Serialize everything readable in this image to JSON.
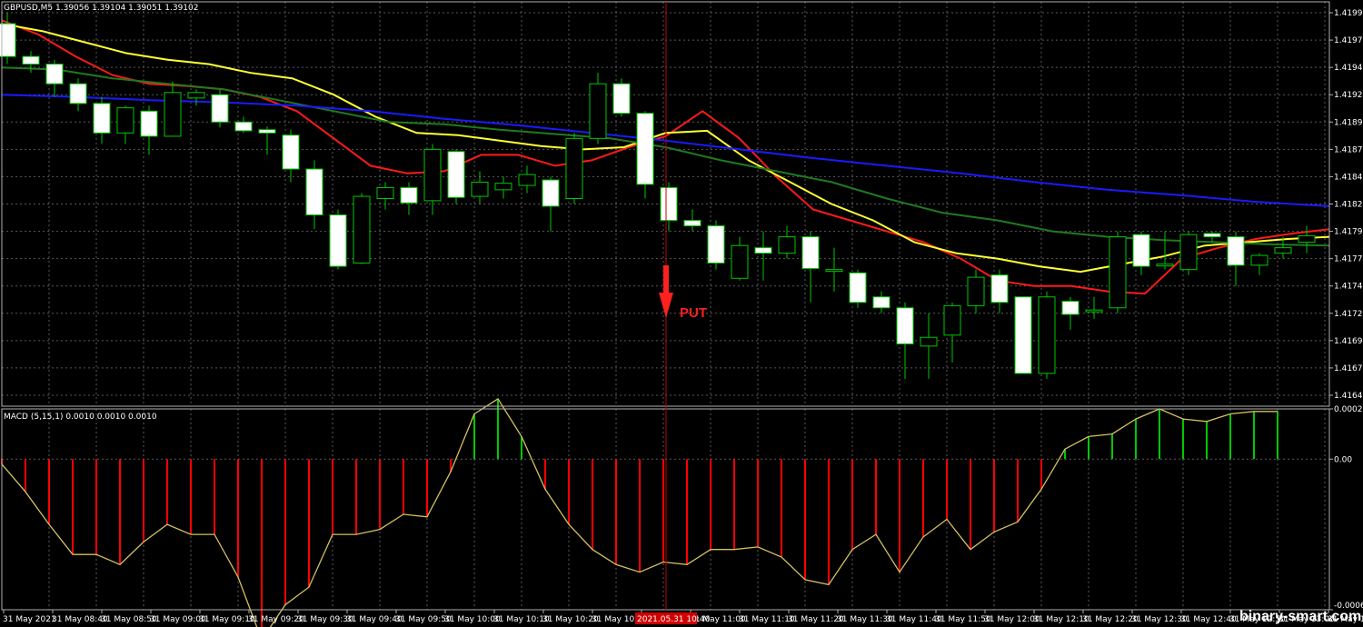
{
  "chart_data": [
    {
      "type": "candlestick",
      "title": "GBPUSD,M5  1.39056 1.39104 1.39051 1.39102",
      "ylim": [
        1.41635,
        1.42005
      ],
      "price_ticks": [
        "1.41995",
        "1.41970",
        "1.41945",
        "1.41920",
        "1.41895",
        "1.41870",
        "1.41845",
        "1.41820",
        "1.41795",
        "1.41770",
        "1.41745",
        "1.41720",
        "1.41695",
        "1.41670",
        "1.41645"
      ],
      "grid": true,
      "candles": [
        {
          "o": 1.41985,
          "h": 1.41995,
          "l": 1.41948,
          "c": 1.41955
        },
        {
          "o": 1.41955,
          "h": 1.4196,
          "l": 1.4194,
          "c": 1.41948
        },
        {
          "o": 1.41948,
          "h": 1.41952,
          "l": 1.41918,
          "c": 1.4193
        },
        {
          "o": 1.4193,
          "h": 1.41935,
          "l": 1.41905,
          "c": 1.41912
        },
        {
          "o": 1.41912,
          "h": 1.41918,
          "l": 1.41875,
          "c": 1.41885
        },
        {
          "o": 1.41885,
          "h": 1.4191,
          "l": 1.41875,
          "c": 1.41908
        },
        {
          "o": 1.41905,
          "h": 1.4191,
          "l": 1.41865,
          "c": 1.41882
        },
        {
          "o": 1.41882,
          "h": 1.41932,
          "l": 1.41882,
          "c": 1.41922
        },
        {
          "o": 1.41917,
          "h": 1.41925,
          "l": 1.4191,
          "c": 1.41922
        },
        {
          "o": 1.4192,
          "h": 1.41925,
          "l": 1.4189,
          "c": 1.41895
        },
        {
          "o": 1.41895,
          "h": 1.419,
          "l": 1.41885,
          "c": 1.41887
        },
        {
          "o": 1.41888,
          "h": 1.41891,
          "l": 1.41865,
          "c": 1.41885
        },
        {
          "o": 1.41883,
          "h": 1.41888,
          "l": 1.4184,
          "c": 1.41852
        },
        {
          "o": 1.41852,
          "h": 1.4186,
          "l": 1.41797,
          "c": 1.4181
        },
        {
          "o": 1.4181,
          "h": 1.41815,
          "l": 1.4176,
          "c": 1.41763
        },
        {
          "o": 1.41766,
          "h": 1.4183,
          "l": 1.41765,
          "c": 1.41827
        },
        {
          "o": 1.41825,
          "h": 1.4184,
          "l": 1.41815,
          "c": 1.41835
        },
        {
          "o": 1.41835,
          "h": 1.4184,
          "l": 1.4181,
          "c": 1.41821
        },
        {
          "o": 1.41823,
          "h": 1.41875,
          "l": 1.4181,
          "c": 1.4187
        },
        {
          "o": 1.41868,
          "h": 1.4187,
          "l": 1.4182,
          "c": 1.41826
        },
        {
          "o": 1.41827,
          "h": 1.4185,
          "l": 1.4182,
          "c": 1.4184
        },
        {
          "o": 1.41833,
          "h": 1.41845,
          "l": 1.41825,
          "c": 1.41839
        },
        {
          "o": 1.41837,
          "h": 1.41855,
          "l": 1.4183,
          "c": 1.41847
        },
        {
          "o": 1.41842,
          "h": 1.41845,
          "l": 1.41795,
          "c": 1.41818
        },
        {
          "o": 1.41825,
          "h": 1.41885,
          "l": 1.4182,
          "c": 1.4188
        },
        {
          "o": 1.4188,
          "h": 1.4194,
          "l": 1.41875,
          "c": 1.4193
        },
        {
          "o": 1.4193,
          "h": 1.41935,
          "l": 1.419,
          "c": 1.41903
        },
        {
          "o": 1.41903,
          "h": 1.41905,
          "l": 1.41825,
          "c": 1.41838
        },
        {
          "o": 1.41835,
          "h": 1.4184,
          "l": 1.41795,
          "c": 1.41805
        },
        {
          "o": 1.41805,
          "h": 1.41815,
          "l": 1.41795,
          "c": 1.418
        },
        {
          "o": 1.418,
          "h": 1.41805,
          "l": 1.4176,
          "c": 1.41766
        },
        {
          "o": 1.41752,
          "h": 1.4179,
          "l": 1.4175,
          "c": 1.41782
        },
        {
          "o": 1.4178,
          "h": 1.41795,
          "l": 1.4175,
          "c": 1.41775
        },
        {
          "o": 1.41775,
          "h": 1.418,
          "l": 1.4177,
          "c": 1.4179
        },
        {
          "o": 1.4179,
          "h": 1.41795,
          "l": 1.4173,
          "c": 1.41761
        },
        {
          "o": 1.4176,
          "h": 1.4178,
          "l": 1.4174,
          "c": 1.4176
        },
        {
          "o": 1.41757,
          "h": 1.4176,
          "l": 1.41725,
          "c": 1.4173
        },
        {
          "o": 1.41735,
          "h": 1.4174,
          "l": 1.4172,
          "c": 1.41725
        },
        {
          "o": 1.41725,
          "h": 1.4173,
          "l": 1.4166,
          "c": 1.41692
        },
        {
          "o": 1.4169,
          "h": 1.4172,
          "l": 1.4166,
          "c": 1.41698
        },
        {
          "o": 1.417,
          "h": 1.4173,
          "l": 1.41675,
          "c": 1.41727
        },
        {
          "o": 1.41727,
          "h": 1.4176,
          "l": 1.4172,
          "c": 1.41753
        },
        {
          "o": 1.41755,
          "h": 1.4176,
          "l": 1.4172,
          "c": 1.4173
        },
        {
          "o": 1.41735,
          "h": 1.41735,
          "l": 1.41665,
          "c": 1.41665
        },
        {
          "o": 1.41665,
          "h": 1.4174,
          "l": 1.4166,
          "c": 1.41735
        },
        {
          "o": 1.41731,
          "h": 1.41735,
          "l": 1.41705,
          "c": 1.41719
        },
        {
          "o": 1.41722,
          "h": 1.41735,
          "l": 1.41715,
          "c": 1.41723
        },
        {
          "o": 1.41725,
          "h": 1.41795,
          "l": 1.4172,
          "c": 1.4179
        },
        {
          "o": 1.41792,
          "h": 1.41795,
          "l": 1.41755,
          "c": 1.41763
        },
        {
          "o": 1.41764,
          "h": 1.41795,
          "l": 1.4176,
          "c": 1.41765
        },
        {
          "o": 1.4176,
          "h": 1.41795,
          "l": 1.41755,
          "c": 1.41792
        },
        {
          "o": 1.41793,
          "h": 1.41795,
          "l": 1.41785,
          "c": 1.4179
        },
        {
          "o": 1.4179,
          "h": 1.41795,
          "l": 1.41745,
          "c": 1.41764
        },
        {
          "o": 1.41764,
          "h": 1.41775,
          "l": 1.41755,
          "c": 1.41773
        },
        {
          "o": 1.41775,
          "h": 1.4179,
          "l": 1.4177,
          "c": 1.4178
        },
        {
          "o": 1.41785,
          "h": 1.418,
          "l": 1.41775,
          "c": 1.41791
        }
      ],
      "moving_averages": [
        {
          "color": "#ff1a1a",
          "values": [
            1.41988,
            1.41975,
            1.41955,
            1.41938,
            1.4193,
            1.41928,
            1.41925,
            1.41918,
            1.41905,
            1.4188,
            1.41855,
            1.41848,
            1.4185,
            1.41865,
            1.41865,
            1.41855,
            1.4186,
            1.41872,
            1.41882,
            1.41905,
            1.4188,
            1.41845,
            1.41815,
            1.41805,
            1.41795,
            1.41785,
            1.4177,
            1.4175,
            1.41745,
            1.41745,
            1.4174,
            1.41738,
            1.4177,
            1.4178,
            1.41788,
            1.41793,
            1.41797
          ]
        },
        {
          "color": "#ffff33",
          "values": [
            1.41985,
            1.41978,
            1.41968,
            1.41958,
            1.41952,
            1.41948,
            1.4194,
            1.41935,
            1.4192,
            1.419,
            1.41885,
            1.41883,
            1.41878,
            1.41873,
            1.4187,
            1.41872,
            1.41885,
            1.41887,
            1.4186,
            1.4184,
            1.4182,
            1.41805,
            1.41785,
            1.41775,
            1.4177,
            1.41763,
            1.41758,
            1.41765,
            1.41772,
            1.41782,
            1.41785,
            1.41788,
            1.4179
          ]
        },
        {
          "color": "#1f7a1f",
          "values": [
            1.41945,
            1.41943,
            1.41935,
            1.4193,
            1.41925,
            1.41915,
            1.41905,
            1.41895,
            1.41893,
            1.41888,
            1.41884,
            1.4188,
            1.41872,
            1.4186,
            1.4185,
            1.4184,
            1.41825,
            1.41812,
            1.41805,
            1.41795,
            1.4179,
            1.41787,
            1.41785,
            1.41783,
            1.41782
          ]
        },
        {
          "color": "#1a1aff",
          "values": [
            1.4192,
            1.41918,
            1.41915,
            1.41913,
            1.4191,
            1.41905,
            1.41898,
            1.41892,
            1.41885,
            1.41878,
            1.4187,
            1.41862,
            1.41855,
            1.41848,
            1.4184,
            1.41833,
            1.41828,
            1.41822,
            1.41818
          ]
        }
      ],
      "signal": {
        "label": "PUT",
        "direction": "down",
        "candle_index": 28
      }
    },
    {
      "type": "histogram",
      "title": "MACD (5,15,1) 0.0010 0.0010 0.0010",
      "ylim": [
        -0.0006,
        0.0002
      ],
      "tick_labels": [
        "0.0002",
        "0.00",
        "-0.0006"
      ],
      "values": [
        -2e-05,
        -0.00013,
        -0.00026,
        -0.00038,
        -0.00038,
        -0.00042,
        -0.00033,
        -0.00026,
        -0.0003,
        -0.0003,
        -0.00047,
        -0.00072,
        -0.00058,
        -0.00051,
        -0.0003,
        -0.0003,
        -0.00028,
        -0.00022,
        -0.00023,
        -5e-05,
        0.00018,
        0.00024,
        9e-05,
        -0.00012,
        -0.00026,
        -0.00036,
        -0.00042,
        -0.00045,
        -0.00041,
        -0.00042,
        -0.00036,
        -0.00036,
        -0.00035,
        -0.00039,
        -0.00048,
        -0.0005,
        -0.00036,
        -0.0003,
        -0.00045,
        -0.00031,
        -0.00024,
        -0.00036,
        -0.00029,
        -0.00025,
        -0.00012,
        4e-05,
        9e-05,
        0.0001,
        0.00016,
        0.0002,
        0.00016,
        0.00015,
        0.00018,
        0.00019,
        0.00019
      ]
    }
  ],
  "time_labels": [
    "31 May 2021",
    "31 May 08:40",
    "31 May 08:50",
    "31 May 09:00",
    "31 May 09:10",
    "31 May 09:20",
    "31 May 09:30",
    "31 May 09:40",
    "31 May 09:50",
    "31 May 10:00",
    "31 May 10:10",
    "31 May 10:20",
    "31 May 10:30",
    "31 May 10:50",
    "31 May 11:00",
    "31 May 11:10",
    "31 May 11:20",
    "31 May 11:30",
    "31 May 11:40",
    "31 May 11:50",
    "31 May 12:00",
    "31 May 12:10",
    "31 May 12:20",
    "31 May 12:30",
    "31 May 12:40",
    "31 May 12:50",
    "31 May 13:00",
    "31 May 13:0"
  ],
  "cursor_time_label": "2021.05.31 10:40",
  "watermark": "binary-smart.com",
  "colors": {
    "bull_body": "#000000",
    "bull_border": "#00c800",
    "bear_body": "#ffffff",
    "wick": "#00c800",
    "grid": "#5a5a5a",
    "macd_pos": "#00c800",
    "macd_neg": "#ff0000",
    "macd_line": "#d4c060",
    "cursor": "#c00000"
  }
}
